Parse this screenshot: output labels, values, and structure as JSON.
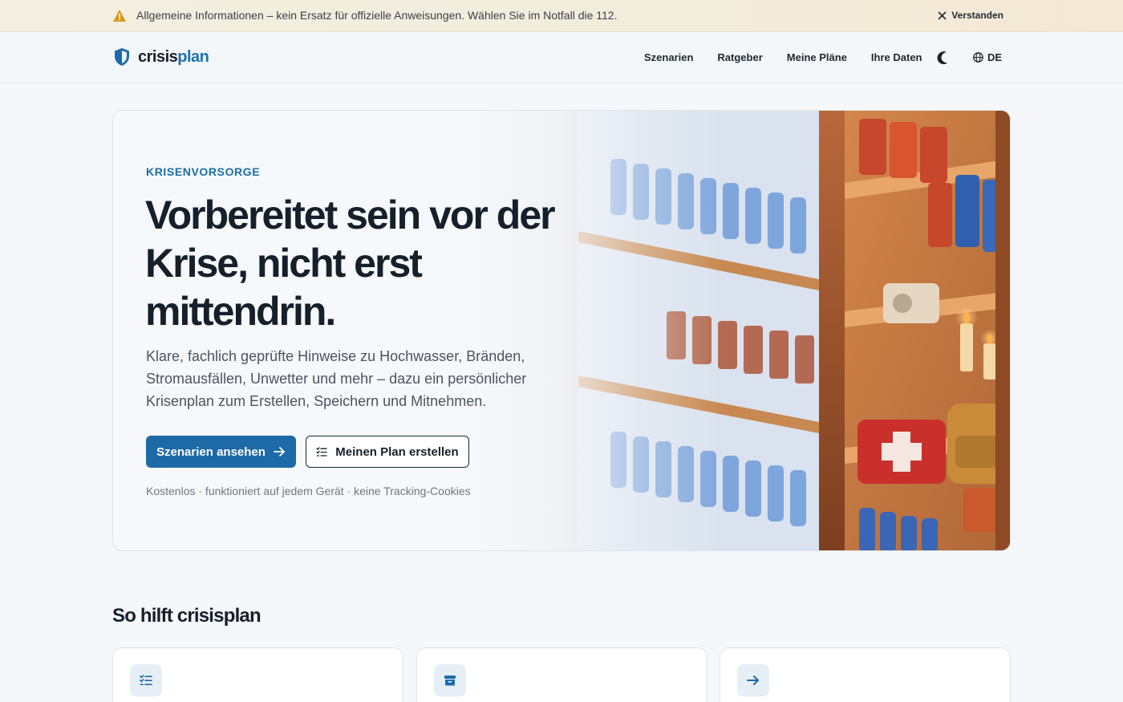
{
  "notice": {
    "text": "Allgemeine Informationen – kein Ersatz für offizielle Anweisungen. Wählen Sie im Notfall die 112.",
    "dismiss_label": "Verstanden",
    "icon": "warning-icon",
    "icon_color": "#d99a1e"
  },
  "header": {
    "logo_part1": "crisis",
    "logo_part2": "plan",
    "nav": [
      "Szenarien",
      "Ratgeber",
      "Meine Pläne",
      "Ihre Daten"
    ],
    "theme_icon": "moon-icon",
    "language": "DE",
    "language_icon": "globe-icon"
  },
  "hero": {
    "eyebrow": "KRISENVORSORGE",
    "title": "Vorbereitet sein vor der Krise, nicht erst mittendrin.",
    "lead": "Klare, fachlich geprüfte Hinweise zu Hochwasser, Bränden, Stromausfällen, Unwetter und mehr – dazu ein persönlicher Krisenplan zum Erstellen, Speichern und Mitnehmen.",
    "primary_button": "Szenarien ansehen",
    "secondary_button": "Meinen Plan erstellen",
    "note": "Kostenlos · funktioniert auf jedem Gerät · keine Tracking-Cookies"
  },
  "section": {
    "title": "So hilft crisisplan",
    "cards": [
      {
        "icon": "checklist-icon"
      },
      {
        "icon": "archive-box-icon"
      },
      {
        "icon": "arrow-right-icon"
      }
    ]
  },
  "colors": {
    "accent": "#1d6aa7",
    "text": "#16202b",
    "background": "#f5f7fa"
  }
}
